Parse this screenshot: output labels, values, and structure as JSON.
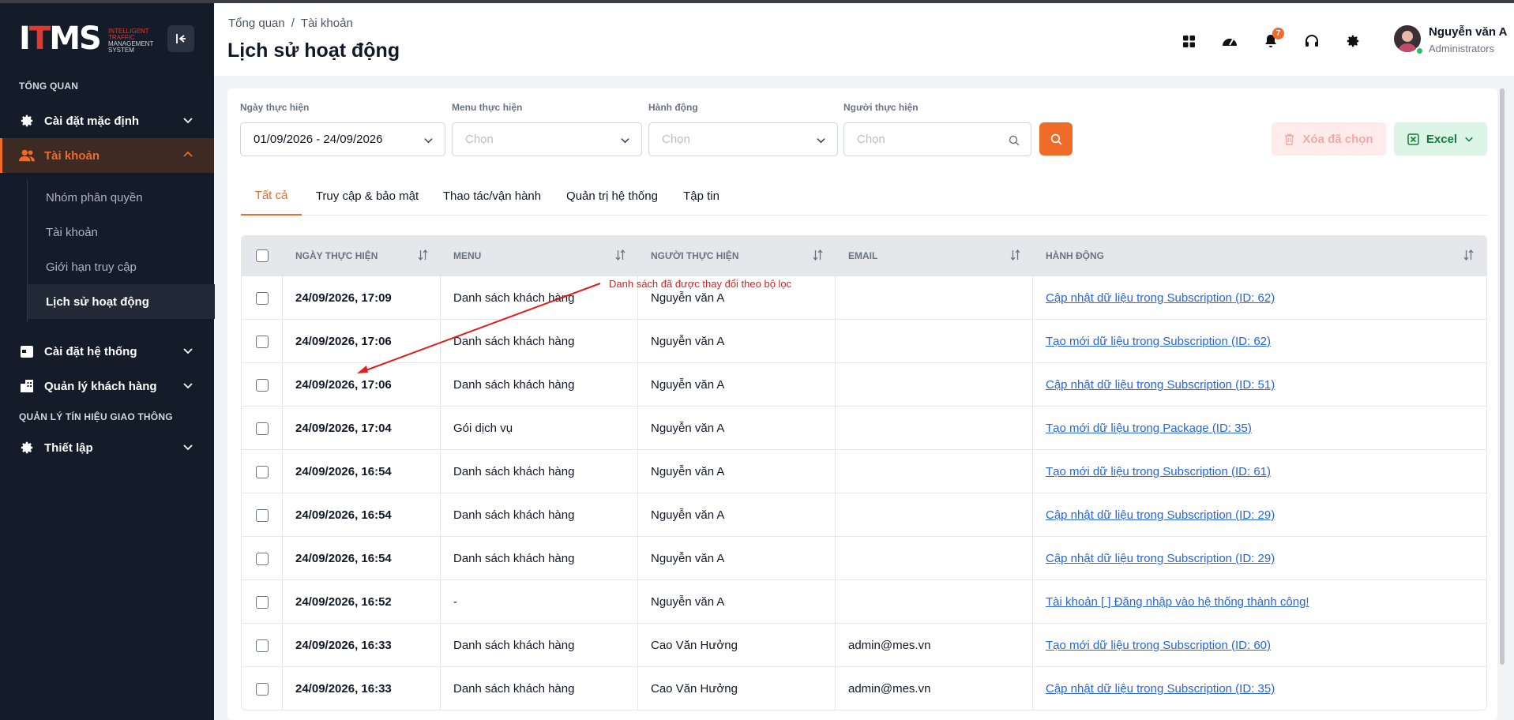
{
  "app": {
    "logo_main": "ITMS",
    "logo_sub_lines": [
      "INTELLIGENT",
      "TRAFFIC",
      "MANAGEMENT",
      "SYSTEM"
    ]
  },
  "sidebar": {
    "section_overview": "TỔNG QUAN",
    "section_traffic": "QUẢN LÝ TÍN HIỆU GIAO THÔNG",
    "items": [
      {
        "label": "Cài đặt mặc định",
        "icon": "gear-icon"
      },
      {
        "label": "Tài khoản",
        "icon": "users-icon"
      },
      {
        "label": "Cài đặt hệ thống",
        "icon": "calendar-icon"
      },
      {
        "label": "Quản lý khách hàng",
        "icon": "building-icon"
      },
      {
        "label": "Thiết lập",
        "icon": "gear-icon"
      }
    ],
    "sub_items": [
      "Nhóm phân quyền",
      "Tài khoản",
      "Giới hạn truy cập",
      "Lịch sử hoạt động"
    ]
  },
  "header": {
    "breadcrumb": [
      "Tổng quan",
      "/",
      "Tài khoản"
    ],
    "title": "Lịch sử hoạt động",
    "notification_count": "7",
    "user_name": "Nguyễn văn A",
    "user_role": "Administrators"
  },
  "filters": {
    "date_label": "Ngày thực hiện",
    "date_value": "01/09/2026 - 24/09/2026",
    "menu_label": "Menu thực hiện",
    "menu_placeholder": "Chọn",
    "action_label": "Hành động",
    "action_placeholder": "Chọn",
    "user_label": "Người thực hiện",
    "user_placeholder": "Chọn",
    "delete_label": "Xóa đã chọn",
    "excel_label": "Excel"
  },
  "tabs": [
    "Tất cả",
    "Truy cập & bảo mật",
    "Thao tác/vận hành",
    "Quản trị hệ thống",
    "Tập tin"
  ],
  "table": {
    "columns": [
      "NGÀY THỰC HIỆN",
      "MENU",
      "NGƯỜI THỰC HIỆN",
      "EMAIL",
      "HÀNH ĐỘNG"
    ],
    "rows": [
      {
        "date": "24/09/2026, 17:09",
        "menu": "Danh sách khách hàng",
        "user": "Nguyễn văn A",
        "email": "",
        "action": "Cập nhật dữ liệu trong Subscription (ID: 62)"
      },
      {
        "date": "24/09/2026, 17:06",
        "menu": "Danh sách khách hàng",
        "user": "Nguyễn văn A",
        "email": "",
        "action": "Tạo mới dữ liệu trong Subscription (ID: 62)"
      },
      {
        "date": "24/09/2026, 17:06",
        "menu": "Danh sách khách hàng",
        "user": "Nguyễn văn A",
        "email": "",
        "action": "Cập nhật dữ liệu trong Subscription (ID: 51)"
      },
      {
        "date": "24/09/2026, 17:04",
        "menu": "Gói dịch vụ",
        "user": "Nguyễn văn A",
        "email": "",
        "action": "Tạo mới dữ liệu trong Package (ID: 35)"
      },
      {
        "date": "24/09/2026, 16:54",
        "menu": "Danh sách khách hàng",
        "user": "Nguyễn văn A",
        "email": "",
        "action": "Tạo mới dữ liệu trong Subscription (ID: 61)"
      },
      {
        "date": "24/09/2026, 16:54",
        "menu": "Danh sách khách hàng",
        "user": "Nguyễn văn A",
        "email": "",
        "action": "Cập nhật dữ liệu trong Subscription (ID: 29)"
      },
      {
        "date": "24/09/2026, 16:54",
        "menu": "Danh sách khách hàng",
        "user": "Nguyễn văn A",
        "email": "",
        "action": "Cập nhật dữ liệu trong Subscription (ID: 29)"
      },
      {
        "date": "24/09/2026, 16:52",
        "menu": "-",
        "user": "Nguyễn văn A",
        "email": "",
        "action": "Tài khoản [ ] Đăng nhập vào hệ thống thành công!"
      },
      {
        "date": "24/09/2026, 16:33",
        "menu": "Danh sách khách hàng",
        "user": "Cao Văn Hưởng",
        "email": "admin@mes.vn",
        "action": "Tạo mới dữ liệu trong Subscription (ID: 60)"
      },
      {
        "date": "24/09/2026, 16:33",
        "menu": "Danh sách khách hàng",
        "user": "Cao Văn Hưởng",
        "email": "admin@mes.vn",
        "action": "Cập nhật dữ liệu trong Subscription (ID: 35)"
      }
    ]
  },
  "annotation": "Danh sách đã được thay đổi theo bộ lọc",
  "colors": {
    "accent": "#f06a28",
    "sidebar_bg": "#141b29",
    "link": "#2563eb",
    "annotation": "#e11d1d"
  }
}
